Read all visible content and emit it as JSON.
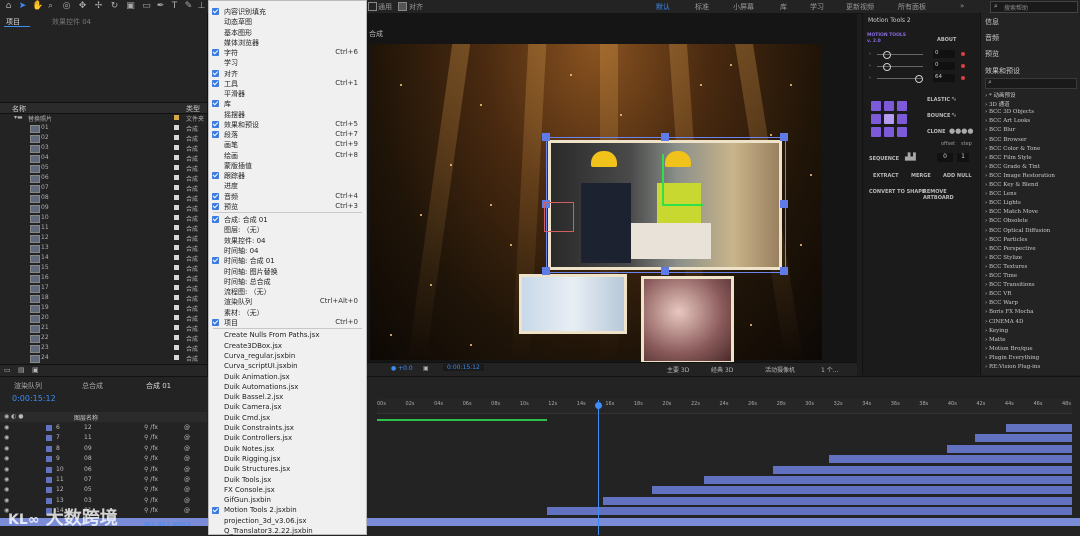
{
  "toolbar": {
    "workspaces": [
      "默认",
      "标准",
      "小屏幕",
      "库",
      "学习",
      "更新视频",
      "所有面板"
    ],
    "snap_label": "通用",
    "align_label": "对齐",
    "search_placeholder": "搜索帮助"
  },
  "project": {
    "tab": "项目",
    "effect_tab": "效果控件 04",
    "col_name": "名称",
    "col_type": "类型",
    "folder": "替换照片",
    "folder_type": "文件夹",
    "rows": [
      "01",
      "02",
      "03",
      "04",
      "05",
      "06",
      "07",
      "08",
      "09",
      "10",
      "11",
      "12",
      "13",
      "14",
      "15",
      "16",
      "17",
      "18",
      "19",
      "20",
      "21",
      "22",
      "23",
      "24"
    ],
    "row_type": "合成"
  },
  "menu": {
    "items_top": [
      {
        "label": "内容识别填充",
        "checked": true,
        "shortcut": ""
      },
      {
        "label": "动态草图",
        "checked": false,
        "shortcut": ""
      },
      {
        "label": "基本图形",
        "checked": false,
        "shortcut": ""
      },
      {
        "label": "媒体浏览器",
        "checked": false,
        "shortcut": ""
      },
      {
        "label": "字符",
        "checked": true,
        "shortcut": "Ctrl+6"
      },
      {
        "label": "学习",
        "checked": false,
        "shortcut": ""
      },
      {
        "label": "对齐",
        "checked": true,
        "shortcut": ""
      },
      {
        "label": "工具",
        "checked": true,
        "shortcut": "Ctrl+1"
      },
      {
        "label": "平滑器",
        "checked": false,
        "shortcut": ""
      },
      {
        "label": "库",
        "checked": true,
        "shortcut": ""
      },
      {
        "label": "摇摆器",
        "checked": false,
        "shortcut": ""
      },
      {
        "label": "效果和预设",
        "checked": true,
        "shortcut": "Ctrl+5"
      },
      {
        "label": "段落",
        "checked": true,
        "shortcut": "Ctrl+7"
      },
      {
        "label": "画笔",
        "checked": false,
        "shortcut": "Ctrl+9"
      },
      {
        "label": "绘画",
        "checked": false,
        "shortcut": "Ctrl+8"
      },
      {
        "label": "蒙版插值",
        "checked": false,
        "shortcut": ""
      },
      {
        "label": "跟踪器",
        "checked": true,
        "shortcut": ""
      },
      {
        "label": "进度",
        "checked": false,
        "shortcut": ""
      },
      {
        "label": "音频",
        "checked": true,
        "shortcut": "Ctrl+4"
      },
      {
        "label": "预览",
        "checked": true,
        "shortcut": "Ctrl+3"
      }
    ],
    "items_mid": [
      {
        "label": "合成: 合成 01",
        "checked": true,
        "shortcut": ""
      },
      {
        "label": "图层: （无）",
        "checked": false,
        "shortcut": ""
      },
      {
        "label": "效果控件: 04",
        "checked": false,
        "shortcut": ""
      },
      {
        "label": "时间轴: 04",
        "checked": false,
        "shortcut": ""
      },
      {
        "label": "时间轴: 合成 01",
        "checked": true,
        "shortcut": ""
      },
      {
        "label": "时间轴: 图片替换",
        "checked": false,
        "shortcut": ""
      },
      {
        "label": "时间轴: 总合成",
        "checked": false,
        "shortcut": ""
      },
      {
        "label": "流程图: （无）",
        "checked": false,
        "shortcut": ""
      },
      {
        "label": "渲染队列",
        "checked": false,
        "shortcut": "Ctrl+Alt+0"
      },
      {
        "label": "素材: （无）",
        "checked": false,
        "shortcut": ""
      },
      {
        "label": "项目",
        "checked": true,
        "shortcut": "Ctrl+0"
      }
    ],
    "scripts": [
      {
        "label": "Create Nulls From Paths.jsx",
        "checked": false
      },
      {
        "label": "Create3DBox.jsx",
        "checked": false
      },
      {
        "label": "Curva_regular.jsxbin",
        "checked": false
      },
      {
        "label": "Curva_scriptUI.jsxbin",
        "checked": false
      },
      {
        "label": "Duik Animation.jsx",
        "checked": false
      },
      {
        "label": "Duik Automations.jsx",
        "checked": false
      },
      {
        "label": "Duik Bassel.2.jsx",
        "checked": false
      },
      {
        "label": "Duik Camera.jsx",
        "checked": false
      },
      {
        "label": "Duik Cmd.jsx",
        "checked": false
      },
      {
        "label": "Duik Constraints.jsx",
        "checked": false
      },
      {
        "label": "Duik Controllers.jsx",
        "checked": false
      },
      {
        "label": "Duik Notes.jsx",
        "checked": false
      },
      {
        "label": "Duik Rigging.jsx",
        "checked": false
      },
      {
        "label": "Duik Structures.jsx",
        "checked": false
      },
      {
        "label": "Duik Tools.jsx",
        "checked": false
      },
      {
        "label": "FX Console.jsx",
        "checked": false
      },
      {
        "label": "GifGun.jsxbin",
        "checked": false
      },
      {
        "label": "Motion Tools 2.jsxbin",
        "checked": true
      },
      {
        "label": "projection_3d_v3.06.jsx",
        "checked": false
      },
      {
        "label": "Q_Translator3.2.22.jsxbin",
        "checked": false
      }
    ]
  },
  "viewer": {
    "tab": "合成",
    "timecode": "0:00:15:12",
    "renderer": "主要 3D",
    "view": "经典 3D",
    "camera": "活动摄像机",
    "views": "1 个..."
  },
  "motion_tools": {
    "title": "Motion Tools 2",
    "brand": "MOTION TOOLS v. 2.0",
    "about": "ABOUT",
    "values": [
      "0",
      "0",
      "64"
    ],
    "elastic": "ELASTIC",
    "bounce": "BOUNCE",
    "clone": "CLONE",
    "offset": "offset",
    "step": "step",
    "sequence": "SEQUENCE",
    "seq_values": [
      "0",
      "1"
    ],
    "extract": "EXTRACT",
    "merge": "MERGE",
    "add_null": "ADD NULL",
    "convert": "CONVERT TO SHAPE",
    "remove": "REMOVE ARTBOARD"
  },
  "effects_panel": {
    "info": "信息",
    "audio": "音频",
    "preview": "预览",
    "title": "效果和预设",
    "items": [
      "* 动画预设",
      "3D 通道",
      "BCC 3D Objects",
      "BCC Art Looks",
      "BCC Blur",
      "BCC Browser",
      "BCC Color & Tone",
      "BCC Film Style",
      "BCC Grade & Tint",
      "BCC Image Restoration",
      "BCC Key & Blend",
      "BCC Lens",
      "BCC Lights",
      "BCC Match Move",
      "BCC Obsolete",
      "BCC Optical Diffusion",
      "BCC Particles",
      "BCC Perspective",
      "BCC Stylize",
      "BCC Textures",
      "BCC Time",
      "BCC Transitions",
      "BCC VR",
      "BCC Warp",
      "Boris FX Mocha",
      "CINEMA 4D",
      "Keying",
      "Matte",
      "Motion Bro/que",
      "Plugin Everything",
      "RE:Vision Plug-ins"
    ]
  },
  "timeline": {
    "tabs": [
      "渲染队列",
      "总合成",
      "合成 01"
    ],
    "timecode": "0:00:15:12",
    "col_name": "图层名称",
    "layers": [
      {
        "num": "6",
        "name": "12"
      },
      {
        "num": "7",
        "name": "11"
      },
      {
        "num": "8",
        "name": "09"
      },
      {
        "num": "9",
        "name": "08"
      },
      {
        "num": "10",
        "name": "06"
      },
      {
        "num": "11",
        "name": "07"
      },
      {
        "num": "12",
        "name": "05"
      },
      {
        "num": "13",
        "name": "03"
      },
      {
        "num": "14",
        "name": "01"
      }
    ],
    "layer_starts": [
      0.905,
      0.86,
      0.82,
      0.65,
      0.57,
      0.47,
      0.395,
      0.325,
      0.245,
      0.25
    ],
    "ticks": [
      "00s",
      "02s",
      "04s",
      "06s",
      "08s",
      "10s",
      "12s",
      "14s",
      "16s",
      "18s",
      "20s",
      "22s",
      "24s",
      "26s",
      "28s",
      "30s",
      "32s",
      "34s",
      "36s",
      "38s",
      "40s",
      "42s",
      "44s",
      "46s",
      "48s"
    ],
    "playhead": 0.318,
    "bottom_row": "99.0,-99.7,-9819.8"
  },
  "watermark": "大数跨境",
  "colors": {
    "accent": "#3d8df5",
    "layer_bar": "#6272c0",
    "menu_check": "#3d7be0",
    "mt_purple": "#7d5ad8"
  }
}
